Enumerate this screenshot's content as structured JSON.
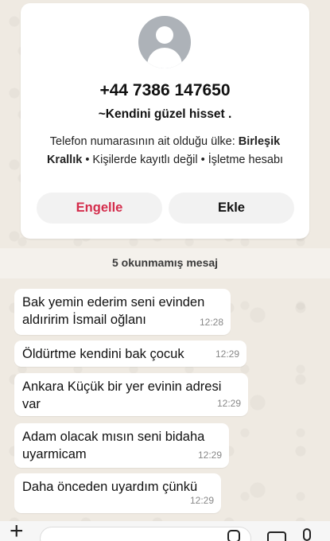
{
  "contact_card": {
    "phone_number": "+44 7386 147650",
    "push_name": "~Kendini güzel hisset .",
    "info_prefix": "Telefon numarasının ait olduğu ülke: ",
    "country": "Birleşik Krallık",
    "info_suffix": " • Kişilerde kayıtlı değil • İşletme hesabı",
    "block_label": "Engelle",
    "add_label": "Ekle"
  },
  "unread_banner": "5 okunmamış mesaj",
  "messages": [
    {
      "text": "Bak yemin ederim seni evinden aldıririm İsmail oğlanı",
      "time": "12:28"
    },
    {
      "text": "Öldürtme kendini bak çocuk",
      "time": "12:29"
    },
    {
      "text": "Ankara Küçük bir yer evinin adresi var",
      "time": "12:29"
    },
    {
      "text": "Adam olacak mısın seni bidaha uyarmicam",
      "time": "12:29"
    },
    {
      "text": "Daha önceden uyardım çünkü",
      "time": "12:29"
    }
  ],
  "colors": {
    "chat_background": "#efeae2",
    "block_red": "#d42d4c",
    "avatar_gray": "#adb2b8"
  },
  "icons": {
    "attach": "plus-icon",
    "sticker": "sticker-icon",
    "camera": "camera-icon",
    "microphone": "mic-icon"
  }
}
